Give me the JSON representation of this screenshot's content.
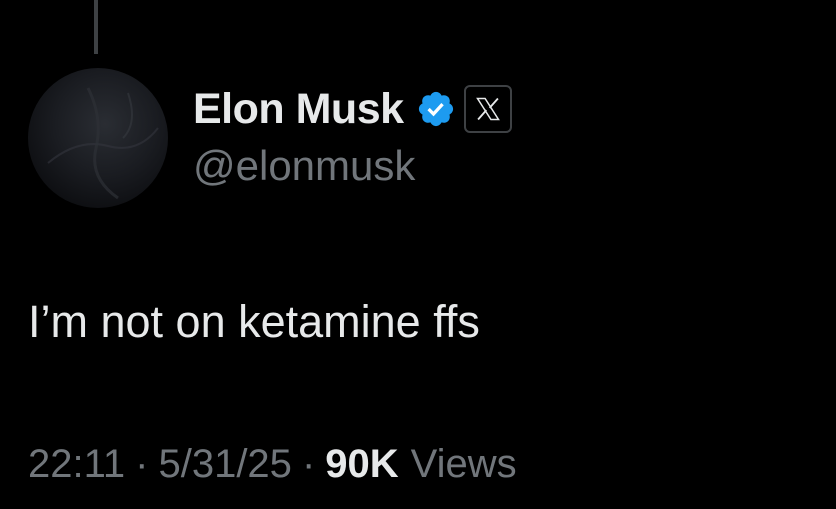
{
  "tweet": {
    "author": {
      "display_name": "Elon Musk",
      "handle": "@elonmusk",
      "verified_icon": "verified-badge-icon",
      "affiliate_icon": "x-logo-icon"
    },
    "text": "I’m not on ketamine ffs",
    "meta": {
      "time": "22:11",
      "separator": "·",
      "date": "5/31/25",
      "views_count": "90K",
      "views_label": "Views"
    }
  },
  "colors": {
    "background": "#000000",
    "primary_text": "#e7e9ea",
    "secondary_text": "#71767b",
    "verified_blue": "#1d9bf0"
  }
}
